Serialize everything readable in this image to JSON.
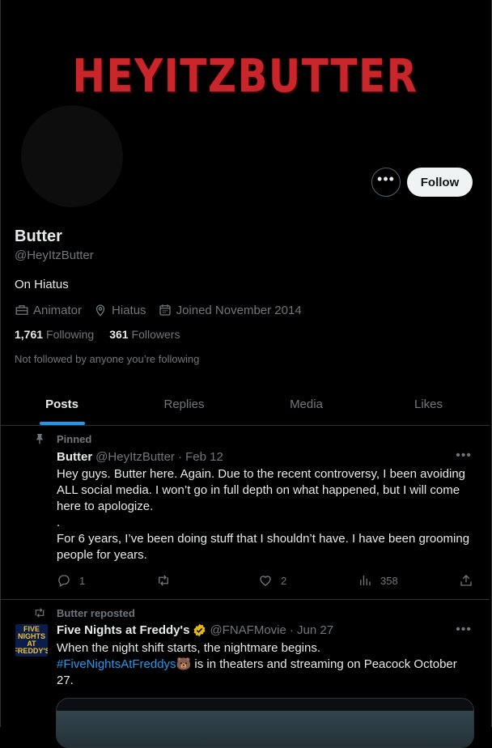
{
  "banner": {
    "title": "HEYITZBUTTER"
  },
  "profile": {
    "name": "Butter",
    "handle": "@HeyItzButter",
    "bio": "On Hiatus",
    "job": "Animator",
    "location": "Hiatus",
    "joined": "Joined November 2014",
    "following_count": "1,761",
    "following_label": "Following",
    "followers_count": "361",
    "followers_label": "Followers",
    "not_followed": "Not followed by anyone you’re following"
  },
  "actions": {
    "more": "•••",
    "follow": "Follow"
  },
  "tabs": [
    {
      "label": "Posts"
    },
    {
      "label": "Replies"
    },
    {
      "label": "Media"
    },
    {
      "label": "Likes"
    }
  ],
  "posts": [
    {
      "context": "Pinned",
      "author": "Butter",
      "handle": "@HeyItzButter",
      "date": "· Feb 12",
      "text": [
        "Hey guys. Butter here. Again. Due to the recent controversy, I been avoiding ALL social media. I won’t go in full depth on what happened, but I will come here to apologize.",
        ".",
        "For 6 years, I’ve been doing stuff that I shouldn’t have. I have been grooming people for years."
      ],
      "replies": "1",
      "reposts": "",
      "likes": "2",
      "views": "358"
    },
    {
      "context": "Butter reposted",
      "author": "Five Nights at Freddy's",
      "handle": "@FNAFMovie",
      "date": "· Jun 27",
      "avatar_text": "FIVE NIGHTS AT FREDDY'S",
      "text_1": "When the night shift starts, the nightmare begins.",
      "hashtag": "#FiveNightsAtFreddys",
      "emoji": "🐻",
      "text_2": " is in theaters and streaming on Peacock October 27."
    }
  ],
  "colors": {
    "accent": "#1d9bf0",
    "verified": "#e2b719",
    "banner_red": "#c8262a"
  }
}
